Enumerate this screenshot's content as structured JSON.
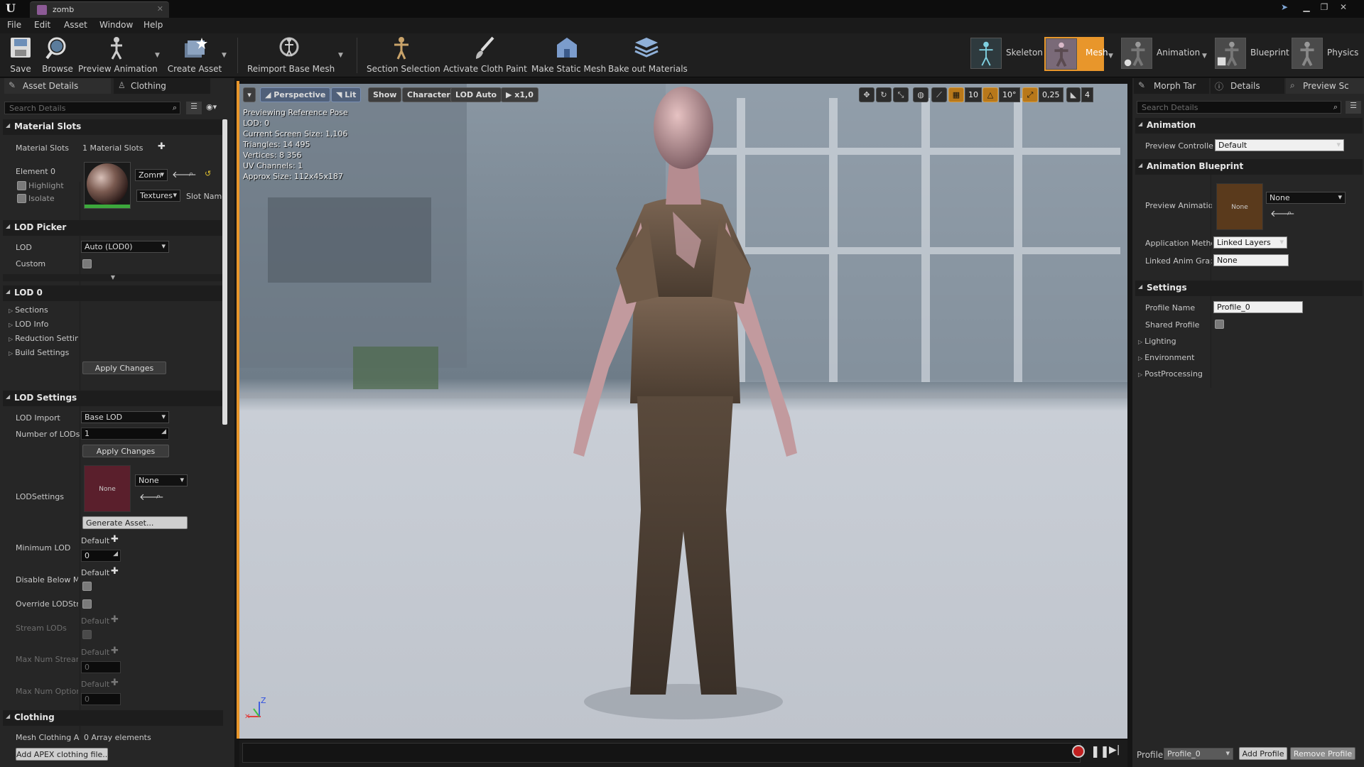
{
  "titlebar": {
    "tab_label": "zomb"
  },
  "menu": [
    "File",
    "Edit",
    "Asset",
    "Window",
    "Help"
  ],
  "toolbar": {
    "buttons": [
      {
        "label": "Save",
        "icon": "save-icon"
      },
      {
        "label": "Browse",
        "icon": "browse-icon"
      },
      {
        "label": "Preview Animation",
        "icon": "preview-animation-icon"
      },
      {
        "label": "Create Asset",
        "icon": "create-asset-icon"
      },
      {
        "label": "Reimport Base Mesh",
        "icon": "reimport-icon"
      },
      {
        "label": "Section Selection",
        "icon": "section-selection-icon"
      },
      {
        "label": "Activate Cloth Paint",
        "icon": "cloth-paint-icon"
      },
      {
        "label": "Make Static Mesh",
        "icon": "static-mesh-icon"
      },
      {
        "label": "Bake out Materials",
        "icon": "bake-materials-icon"
      }
    ],
    "modes": [
      {
        "label": "Skeleton"
      },
      {
        "label": "Mesh",
        "active": true
      },
      {
        "label": "Animation"
      },
      {
        "label": "Blueprint"
      },
      {
        "label": "Physics"
      }
    ]
  },
  "left_panel": {
    "tabs": [
      "Asset Details",
      "Clothing"
    ],
    "search_placeholder": "Search Details",
    "material_slots": {
      "title": "Material Slots",
      "label": "Material Slots",
      "value": "1 Material Slots",
      "element_label": "Element 0",
      "highlight": "Highlight",
      "isolate": "Isolate",
      "material_combo": "Zomn",
      "textures_combo": "Textures",
      "slot_name": "Slot Name"
    },
    "lod_picker": {
      "title": "LOD Picker",
      "lod_label": "LOD",
      "lod_value": "Auto (LOD0)",
      "custom_label": "Custom"
    },
    "lod0": {
      "title": "LOD 0",
      "items": [
        "Sections",
        "LOD Info",
        "Reduction Settings",
        "Build Settings"
      ],
      "apply": "Apply Changes"
    },
    "lod_settings": {
      "title": "LOD Settings",
      "lod_import_label": "LOD Import",
      "lod_import_value": "Base LOD",
      "num_lods_label": "Number of LODs",
      "num_lods_value": "1",
      "apply": "Apply Changes",
      "lodsettings_label": "LODSettings",
      "asset_thumb": "None",
      "asset_combo": "None",
      "generate": "Generate Asset...",
      "min_lod_label": "Minimum LOD",
      "min_lod_default": "Default",
      "min_lod_value": "0",
      "disable_below_label": "Disable Below Mi",
      "disable_below_default": "Default",
      "override_label": "Override LODStre",
      "stream_lods_label": "Stream LODs",
      "stream_default": "Default",
      "max_stream_label": "Max Num Stream",
      "max_stream_default": "Default",
      "max_stream_value": "0",
      "max_optional_label": "Max Num Option",
      "max_optional_default": "Default",
      "max_optional_value": "0"
    },
    "clothing": {
      "title": "Clothing",
      "mesh_label": "Mesh Clothing As",
      "mesh_value": "0 Array elements",
      "add_button": "Add APEX clothing file..."
    }
  },
  "viewport": {
    "toolbar": {
      "perspective": "Perspective",
      "lit": "Lit",
      "show": "Show",
      "character": "Character",
      "lod": "LOD Auto",
      "speed": "x1,0",
      "grid_value": "10",
      "angle_value": "10°",
      "scale_value": "0,25",
      "camera_speed": "4"
    },
    "stats": [
      "Previewing Reference Pose",
      "LOD: 0",
      "Current Screen Size: 1,106",
      "Triangles: 14 495",
      "Vertices: 8 356",
      "UV Channels: 1",
      "Approx Size: 112x45x187"
    ],
    "axis": {
      "z": "Z"
    }
  },
  "right_panel": {
    "tabs": [
      "Morph Tar",
      "Details",
      "Preview Sc"
    ],
    "search_placeholder": "Search Details",
    "animation": {
      "title": "Animation",
      "preview_controller_label": "Preview Controlle",
      "preview_controller_value": "Default"
    },
    "anim_blueprint": {
      "title": "Animation Blueprint",
      "preview_anim_label": "Preview Animatio",
      "thumb": "None",
      "combo": "None",
      "app_method_label": "Application Metho",
      "app_method_value": "Linked Layers",
      "linked_graph_label": "Linked Anim Grapl",
      "linked_graph_value": "None"
    },
    "settings": {
      "title": "Settings",
      "profile_name_label": "Profile Name",
      "profile_name_value": "Profile_0",
      "shared_profile_label": "Shared Profile",
      "items": [
        "Lighting",
        "Environment",
        "PostProcessing"
      ]
    },
    "footer": {
      "profile_label": "Profile",
      "profile_value": "Profile_0",
      "add": "Add Profile",
      "remove": "Remove Profile"
    }
  },
  "colors": {
    "mode_active": "#e8962b",
    "accent_blue": "#5a78b4"
  }
}
